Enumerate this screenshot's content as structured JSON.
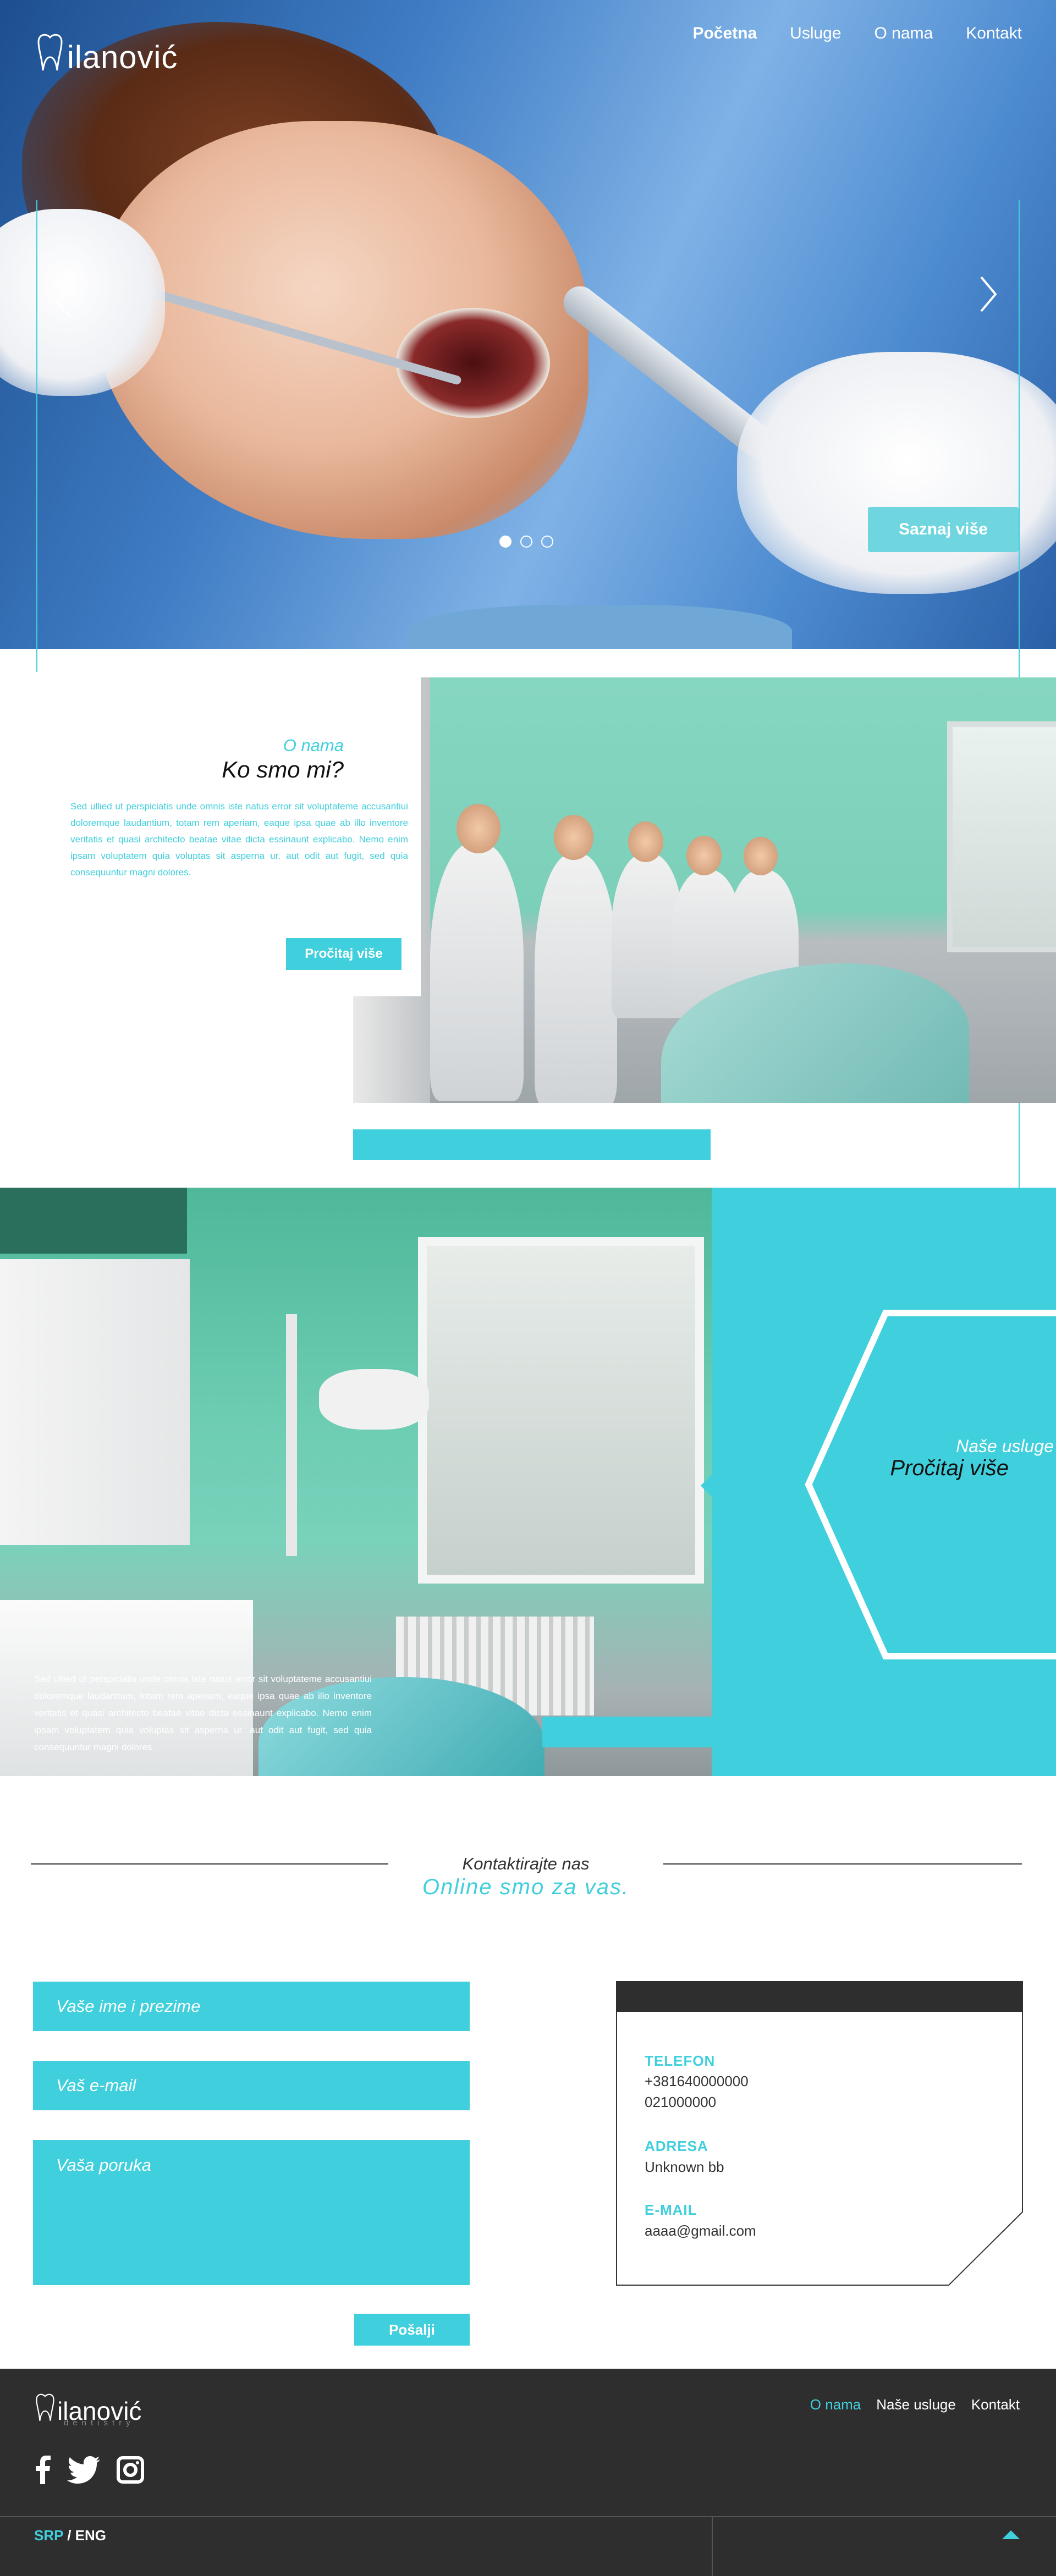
{
  "brand": {
    "logo_text": "ilanović",
    "tagline": "dentistry"
  },
  "nav": {
    "items": [
      {
        "label": "Početna",
        "active": true
      },
      {
        "label": "Usluge",
        "active": false
      },
      {
        "label": "O nama",
        "active": false
      },
      {
        "label": "Kontakt",
        "active": false
      }
    ]
  },
  "hero": {
    "cta_label": "Saznaj više",
    "slides_total": 3,
    "slide_active": 1
  },
  "about": {
    "kicker": "O nama",
    "title": "Ko smo mi?",
    "text": "Sed ullied ut perspiciatis unde omnis iste natus error sit voluptateme accusantiui doloremque laudantium, totam rem aperiam, eaque ipsa quae ab illo inventore veritatis et quasi architecto beatae vitae dicta essinaunt explicabo. Nemo enim ipsam voluptatem quia voluptas sit asperna ur. aut odit aut fugit, sed quia consequuntur magni dolores.",
    "button_label": "Pročitaj više"
  },
  "services": {
    "kicker": "Naše usluge",
    "title": "Pročitaj više",
    "text": "Sed ullied ut perspiciatis unde omnis iste natus error sit voluptateme accusantiui doloremque laudantium, totam rem aperiam, eaque ipsa quae ab illo inventore veritatis et quasi architecto beatae vitae dicta essinaunt explicabo. Nemo enim ipsam voluptatem quia voluptas sit asperna ur. aut odit aut fugit, sed quia consequuntur magni dolores."
  },
  "contact": {
    "kicker": "Kontaktirajte nas",
    "title": "Online smo za vas.",
    "form": {
      "name_placeholder": "Vaše ime i prezime",
      "email_placeholder": "Vaš e-mail",
      "message_placeholder": "Vaša poruka",
      "send_label": "Pošalji"
    },
    "info": {
      "phone_label": "TELEFON",
      "phone_1": "+381640000000",
      "phone_2": "021000000",
      "address_label": "ADRESA",
      "address": "Unknown bb",
      "email_label": "E-MAIL",
      "email": "aaaa@gmail.com"
    }
  },
  "footer": {
    "nav": [
      {
        "label": "O nama",
        "active": true
      },
      {
        "label": "Naše usluge",
        "active": false
      },
      {
        "label": "Kontakt",
        "active": false
      }
    ],
    "social": [
      "facebook-icon",
      "twitter-icon",
      "instagram-icon"
    ],
    "lang_active": "SRP",
    "lang_sep": " / ",
    "lang_other": "ENG"
  },
  "colors": {
    "accent": "#40cfdc",
    "dark": "#2e2e2e"
  }
}
